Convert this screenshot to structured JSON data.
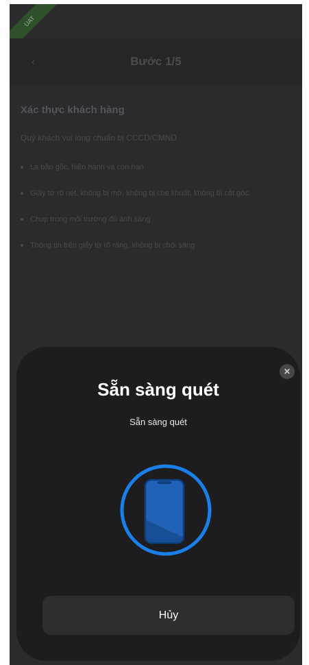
{
  "nav": {
    "title": "Bước 1/5",
    "back_icon": "chevron-left-icon"
  },
  "ribbon": {
    "label": "UAT"
  },
  "content": {
    "title": "Xác thực khách hàng",
    "desc": "Quý khách vui lòng chuẩn bị CCCD/CMND",
    "bullets": [
      "Là bản gốc, hiện hành và còn hạn",
      "Giấy tờ rõ nét, không bị mờ, không bị che khuất, không bị cắt góc",
      "Chụp trong môi trường đủ ánh sáng",
      "Thông tin trên giấy tờ rõ ràng, không bị chói sáng"
    ]
  },
  "sheet": {
    "title": "Sẵn sàng quét",
    "subtitle": "Sẵn sàng quét",
    "close_icon": "close-icon",
    "cancel_label": "Hủy",
    "accent_color": "#1a7fe8",
    "scan_icon": "nfc-phone-scan-icon"
  }
}
